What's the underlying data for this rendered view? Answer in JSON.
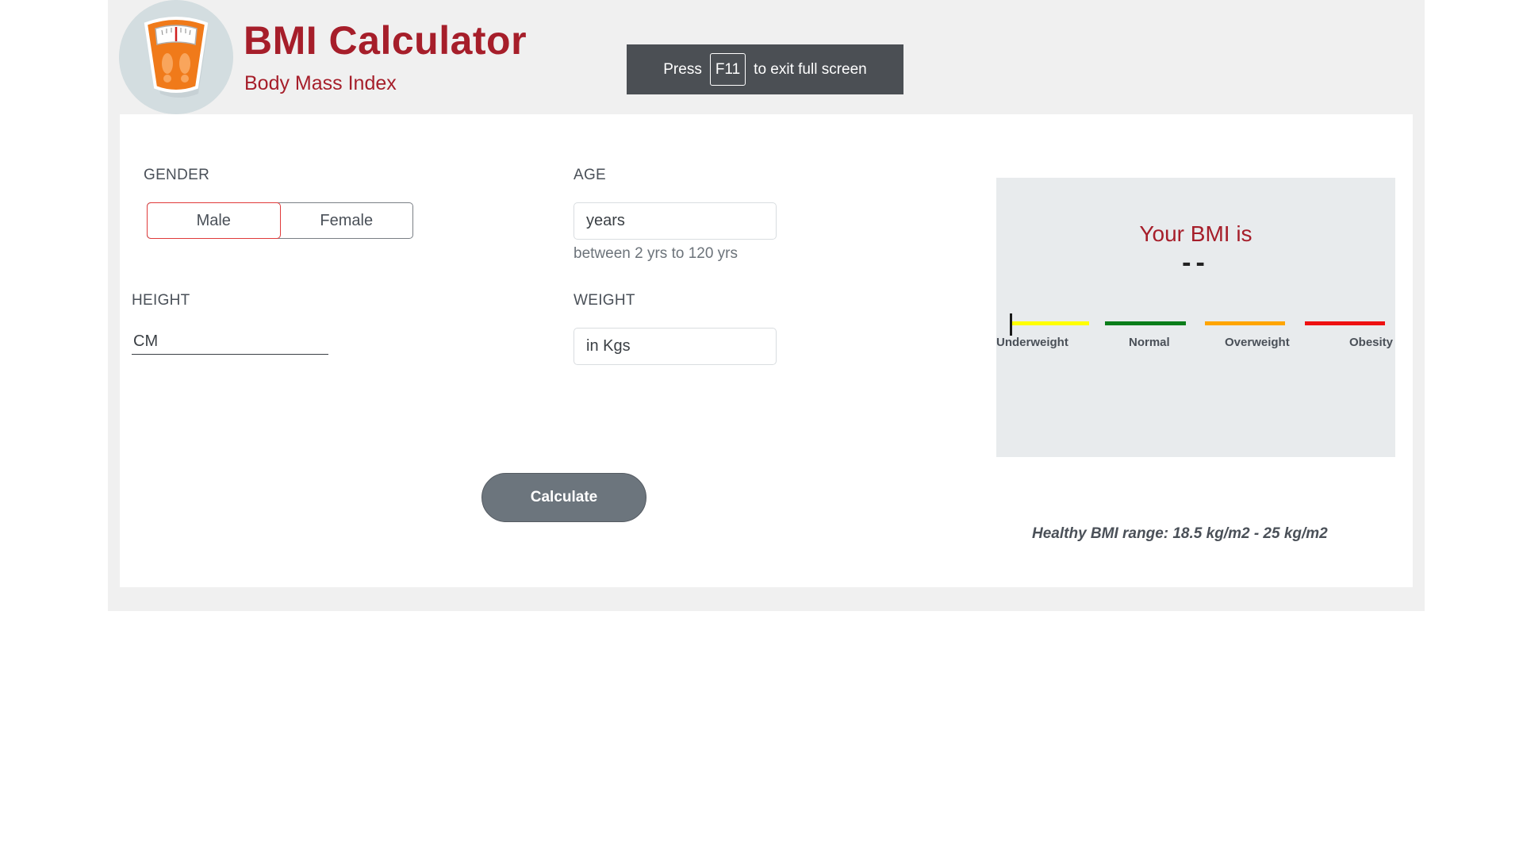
{
  "header": {
    "title": "BMI Calculator",
    "subtitle": "Body Mass Index"
  },
  "fullscreen_notice": {
    "prefix": "Press",
    "key": "F11",
    "suffix": "to exit full screen"
  },
  "form": {
    "gender": {
      "label": "GENDER",
      "options": [
        "Male",
        "Female"
      ],
      "selected": "Male"
    },
    "age": {
      "label": "AGE",
      "placeholder": "years",
      "hint": "between 2 yrs to 120 yrs"
    },
    "height": {
      "label": "HEIGHT",
      "placeholder": "CM"
    },
    "weight": {
      "label": "WEIGHT",
      "placeholder": "in Kgs"
    },
    "calculate_label": "Calculate"
  },
  "result": {
    "title": "Your BMI is",
    "value": "--",
    "scale": [
      {
        "label": "Underweight",
        "color": "#ffff00"
      },
      {
        "label": "Normal",
        "color": "#0a7d1a"
      },
      {
        "label": "Overweight",
        "color": "#ffa500"
      },
      {
        "label": "Obesity",
        "color": "#ee1111"
      }
    ],
    "healthy_range": "Healthy BMI range: 18.5 kg/m2 - 25 kg/m2"
  },
  "colors": {
    "brand": "#a61e2a",
    "accent_selected": "#e03a3a",
    "button": "#6c757d"
  }
}
